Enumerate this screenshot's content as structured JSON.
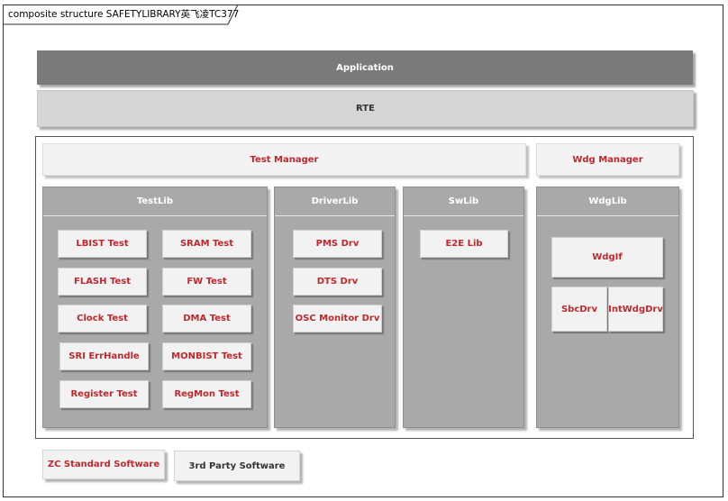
{
  "frame": {
    "title": "composite structure SAFETYLIBRARY英飞凌TC377"
  },
  "layers": {
    "application": "Application",
    "rte": "RTE"
  },
  "managers": {
    "test_manager": "Test Manager",
    "wdg_manager": "Wdg Manager"
  },
  "libs": {
    "testlib": {
      "title": "TestLib",
      "components": [
        "LBIST Test",
        "SRAM Test",
        "FLASH Test",
        "FW Test",
        "Clock Test",
        "DMA Test",
        "SRI ErrHandle",
        "MONBIST Test",
        "Register Test",
        "RegMon Test"
      ]
    },
    "driverlib": {
      "title": "DriverLib",
      "components": [
        "PMS Drv",
        "DTS Drv",
        "OSC Monitor Drv"
      ]
    },
    "swlib": {
      "title": "SwLib",
      "components": [
        "E2E Lib"
      ]
    },
    "wdglib": {
      "title": "WdgLib",
      "components": [
        "WdgIf",
        "SbcDrv",
        "IntWdgDrv"
      ]
    }
  },
  "legend": {
    "zc": "ZC Standard Software",
    "third_party": "3rd Party Software"
  },
  "colors": {
    "highlight_text": "#c0282d",
    "application_bar": "#7a7a7a",
    "rte_bar": "#d6d6d6",
    "lib_bg": "#a9a9a9"
  }
}
